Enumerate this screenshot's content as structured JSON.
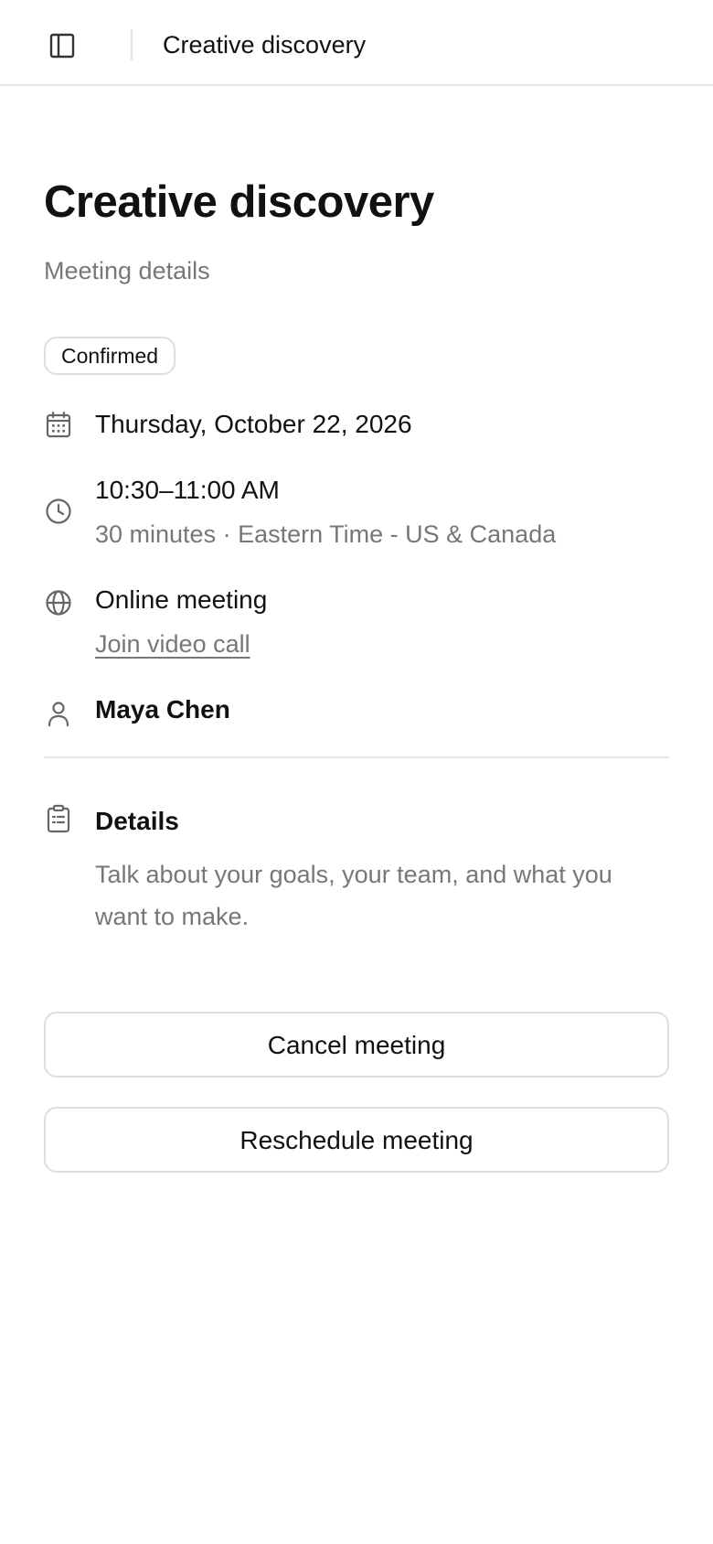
{
  "header": {
    "title": "Creative discovery",
    "sidebar_toggle_icon": "sidebar-panel-icon"
  },
  "page": {
    "title": "Creative discovery",
    "subtitle": "Meeting details"
  },
  "status": {
    "label": "Confirmed"
  },
  "meeting": {
    "date": "Thursday, October 22, 2026",
    "time": "10:30–11:00 AM",
    "duration_timezone": "30 minutes · Eastern Time - US & Canada",
    "location_type": "Online meeting",
    "join_link_label": "Join video call",
    "host": "Maya Chen"
  },
  "details": {
    "heading": "Details",
    "description": "Talk about your goals, your team, and what you want to make."
  },
  "actions": {
    "cancel_label": "Cancel meeting",
    "reschedule_label": "Reschedule meeting"
  },
  "icons": {
    "date": "calendar-icon",
    "time": "clock-icon",
    "location": "globe-icon",
    "host": "person-icon",
    "details": "clipboard-icon"
  },
  "colors": {
    "text_primary": "#111111",
    "text_secondary": "#777777",
    "border": "#dedede",
    "icon": "#666666"
  }
}
